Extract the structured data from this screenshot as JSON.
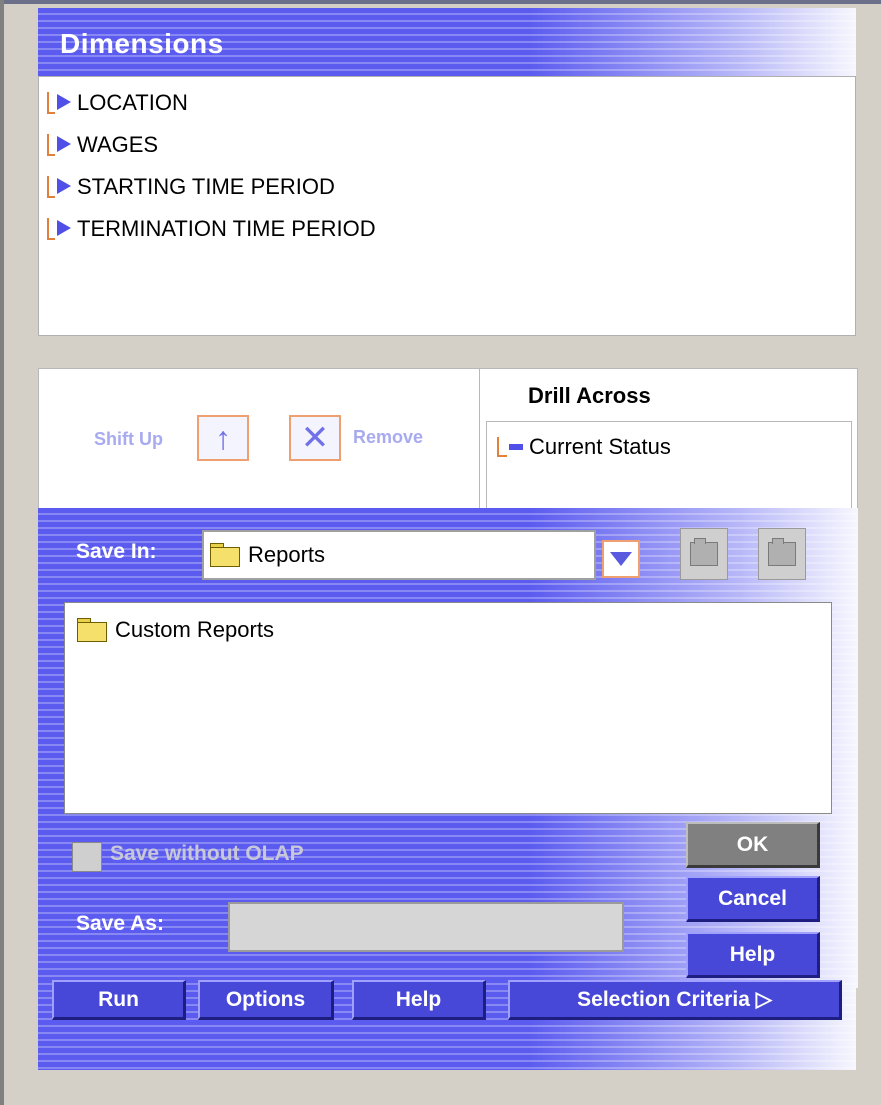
{
  "dimensions": {
    "title": "Dimensions",
    "items": [
      {
        "label": "LOCATION"
      },
      {
        "label": "WAGES"
      },
      {
        "label": "STARTING TIME PERIOD"
      },
      {
        "label": "TERMINATION TIME PERIOD"
      }
    ]
  },
  "controls": {
    "shift_up_label": "Shift Up",
    "remove_label": "Remove",
    "shift_up_glyph": "↑",
    "remove_glyph": "✕"
  },
  "drill_across": {
    "title": "Drill Across",
    "items": [
      {
        "label": "Current Status"
      }
    ]
  },
  "save_dialog": {
    "save_in_label": "Save In:",
    "save_in_value": "Reports",
    "files": [
      {
        "label": "Custom Reports"
      }
    ],
    "save_without_olap_label": "Save without OLAP",
    "save_without_olap_checked": false,
    "save_as_label": "Save As:",
    "save_as_value": "",
    "ok_label": "OK",
    "cancel_label": "Cancel",
    "help_label": "Help"
  },
  "nav": {
    "run_label": "Run",
    "options_label": "Options",
    "help_label": "Help",
    "selection_criteria_label": "Selection Criteria ▷"
  },
  "colors": {
    "accent_blue": "#5b5bf0",
    "bracket_orange": "#e0803a",
    "disabled_text": "#a8aaf0"
  },
  "icons": {
    "dimension_item": "dimension-arrow-icon",
    "drill_item": "drill-measure-icon",
    "folder": "folder-icon",
    "dropdown": "chevron-down-icon",
    "up_folder": "up-folder-icon",
    "new_folder": "new-folder-icon"
  }
}
